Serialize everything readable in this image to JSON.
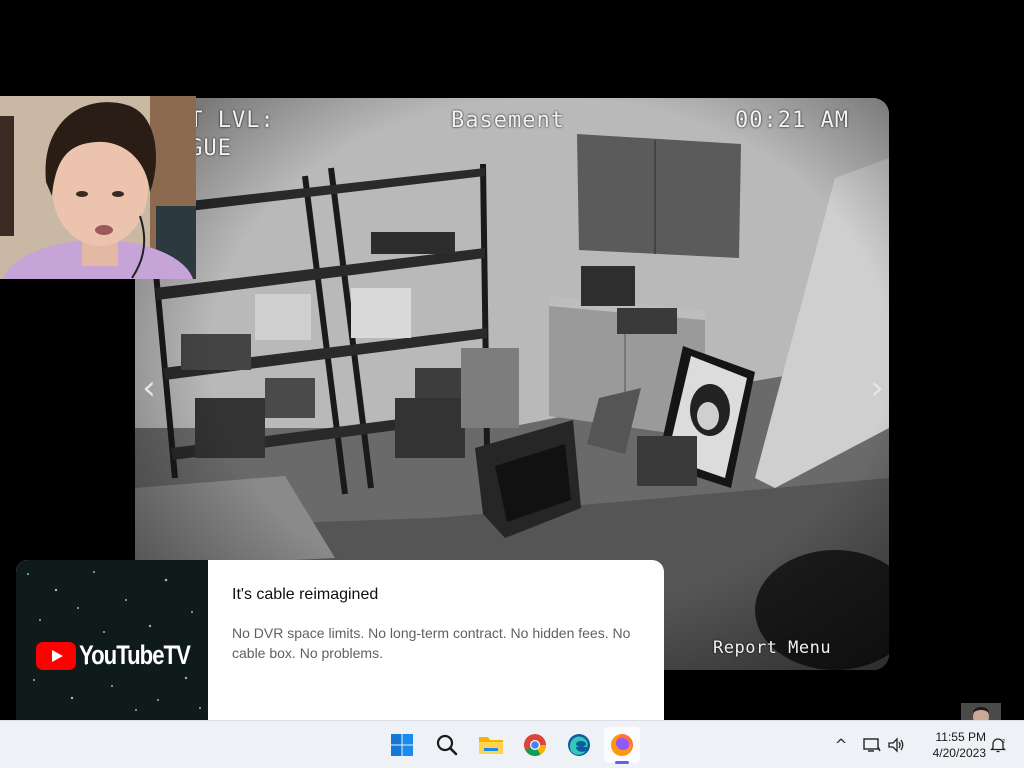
{
  "camera": {
    "level_label": "RT LVL:",
    "level_value": "nGUE",
    "location": "Basement",
    "time": "00:21 AM",
    "footer": "Report Menu",
    "prev_arrow": "‹",
    "next_arrow": "›"
  },
  "ad": {
    "logo_text": "YouTubeTV",
    "title": "It's cable reimagined",
    "description": "No DVR space limits. No long-term contract. No hidden fees. No cable box. No problems.",
    "logo_color": "#ff0000"
  },
  "taskbar": {
    "pinned": [
      {
        "name": "start-icon",
        "label": "Start"
      },
      {
        "name": "search-icon",
        "label": "Search"
      },
      {
        "name": "file-explorer-icon",
        "label": "File Explorer"
      },
      {
        "name": "chrome-icon",
        "label": "Google Chrome"
      },
      {
        "name": "edge-icon",
        "label": "Microsoft Edge"
      },
      {
        "name": "firefox-icon",
        "label": "Firefox",
        "active": true
      }
    ],
    "tray": {
      "chevron": "^",
      "time": "11:55 PM",
      "date": "4/20/2023"
    },
    "accent": "#6c5ce7"
  }
}
